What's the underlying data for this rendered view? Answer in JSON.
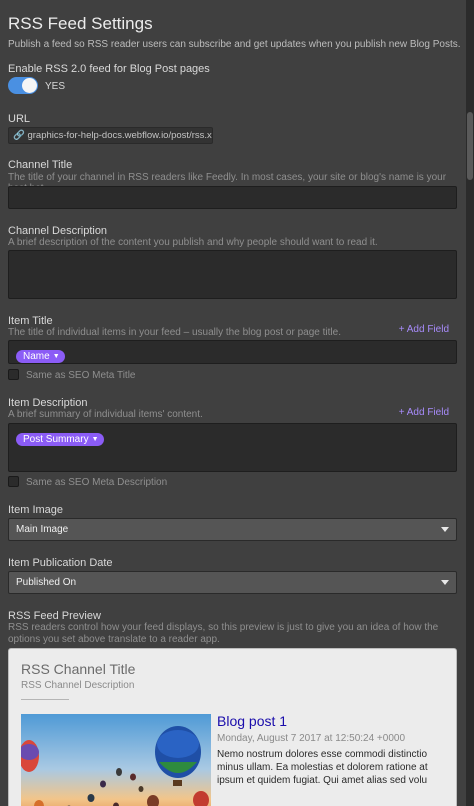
{
  "header": {
    "title": "RSS Feed Settings",
    "subtitle": "Publish a feed so RSS reader users can subscribe and get updates when you publish new Blog Posts."
  },
  "enable": {
    "label": "Enable RSS 2.0 feed for Blog Post pages",
    "toggle_text": "YES",
    "enabled": true
  },
  "url": {
    "label": "URL",
    "value": "graphics-for-help-docs.webflow.io/post/rss.xml"
  },
  "channel_title": {
    "label": "Channel Title",
    "help": "The title of your channel in RSS readers like Feedly. In most cases, your site or blog's name is your best bet.",
    "value": ""
  },
  "channel_description": {
    "label": "Channel Description",
    "help": "A brief description of the content you publish and why people should want to read it.",
    "value": ""
  },
  "item_title": {
    "label": "Item Title",
    "help": "The title of individual items in your feed – usually the blog post or page title.",
    "add_field": "+ Add Field",
    "pill": "Name",
    "checkbox_label": "Same as SEO Meta Title"
  },
  "item_description": {
    "label": "Item Description",
    "help": "A brief summary of individual items' content.",
    "add_field": "+ Add Field",
    "pill": "Post Summary",
    "checkbox_label": "Same as SEO Meta Description"
  },
  "item_image": {
    "label": "Item Image",
    "selected": "Main Image"
  },
  "item_pub_date": {
    "label": "Item Publication Date",
    "selected": "Published On"
  },
  "preview": {
    "label": "RSS Feed Preview",
    "help": "RSS readers control how your feed displays, so this preview is just to give you an idea of how the options you set above translate to a reader app.",
    "channel_title": "RSS Channel Title",
    "channel_description": "RSS Channel Description",
    "item_title": "Blog post 1",
    "item_date": "Monday, August 7 2017 at 12:50:24 +0000",
    "item_body": "Nemo nostrum dolores esse commodi distinctio minus ullam. Ea molestias et dolorem ratione at ipsum et quidem fugiat. Qui amet alias sed volu"
  },
  "colors": {
    "background": "#404040",
    "toggle_on": "#4a90e2",
    "pill": "#8b5cf6",
    "add_field_link": "#a78bfa",
    "preview_link": "#1a0dab"
  }
}
